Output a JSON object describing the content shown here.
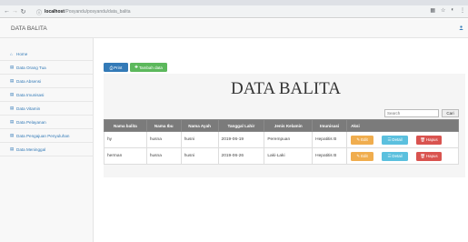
{
  "browser": {
    "host": "localhost",
    "path": "/Posyandu/posyandu/data_balita"
  },
  "header": {
    "brand": "DATA BALITA"
  },
  "sidebar": {
    "items": [
      {
        "label": "Home",
        "icon": "home-icon"
      },
      {
        "label": "Data Orang Tua",
        "icon": "table-icon"
      },
      {
        "label": "Data Absensi",
        "icon": "table-icon"
      },
      {
        "label": "Data Imunisasi",
        "icon": "table-icon"
      },
      {
        "label": "Data Vitamin",
        "icon": "table-icon"
      },
      {
        "label": "Data Pelayanan",
        "icon": "table-icon"
      },
      {
        "label": "Data Pengajuan Penyuluhan",
        "icon": "table-icon"
      },
      {
        "label": "Data Meninggal",
        "icon": "table-icon"
      }
    ]
  },
  "toolbar": {
    "print_label": "Print",
    "tambah_label": "Tambah data"
  },
  "main": {
    "title": "DATA BALITA",
    "search": {
      "placeholder": "Search",
      "button": "Cari"
    }
  },
  "table": {
    "headers": [
      "Nama balita",
      "Nama Ibu",
      "Nama Ayah",
      "Tanggal Lahir",
      "Jenis Kelamin",
      "Imunisasi",
      "Aksi"
    ],
    "rows": [
      [
        "hy",
        "husna",
        "husni",
        "2019-06-19",
        "Perempuan",
        "Hepatitis B"
      ],
      [
        "herman",
        "husna",
        "husni",
        "2019-06-26",
        "Laki-Laki",
        "Hepatitis B"
      ]
    ],
    "actions": {
      "edit": "Edit",
      "detail": "Detail",
      "hapus": "Hapus"
    }
  },
  "colors": {
    "primary": "#337ab7",
    "success": "#5cb85c",
    "warning": "#f0ad4e",
    "info": "#5bc0de",
    "danger": "#d9534f",
    "table_header": "#7b7b7b"
  }
}
